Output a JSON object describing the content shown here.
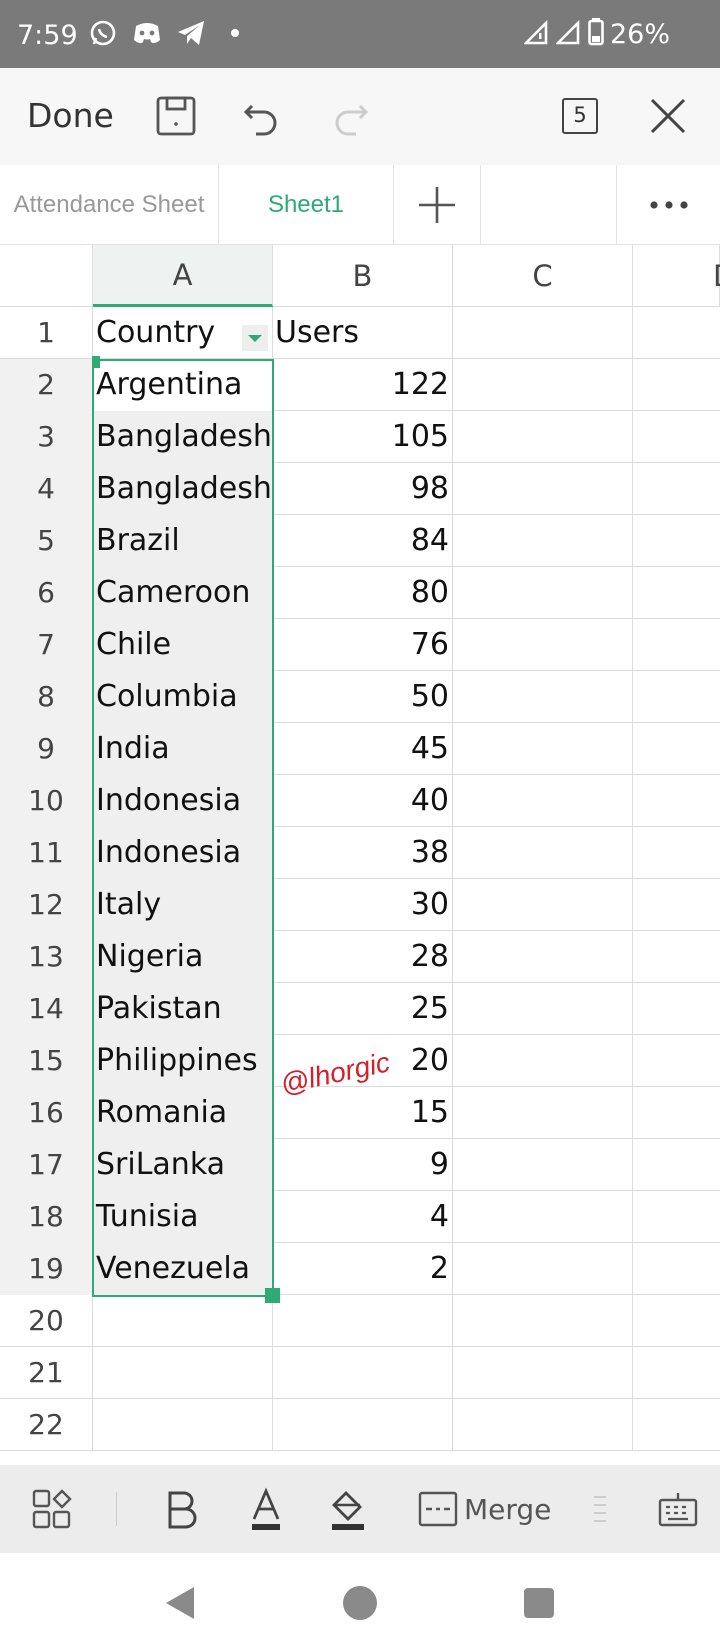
{
  "status_bar": {
    "time": "7:59",
    "battery": "26%",
    "notification_icons": [
      "whatsapp-icon",
      "discord-icon",
      "telegram-icon",
      "dot-icon"
    ]
  },
  "toolbar": {
    "done_label": "Done",
    "tab_count": "5"
  },
  "sheet_tabs": [
    {
      "label": "Attendance Sheet",
      "active": false
    },
    {
      "label": "Sheet1",
      "active": true
    }
  ],
  "columns": [
    "A",
    "B",
    "C",
    "D"
  ],
  "rows": [
    {
      "num": "1",
      "a": "Country",
      "b": "Users"
    },
    {
      "num": "2",
      "a": "Argentina",
      "b": "122"
    },
    {
      "num": "3",
      "a": "Bangladesh",
      "b": "105"
    },
    {
      "num": "4",
      "a": "Bangladesh",
      "b": "98"
    },
    {
      "num": "5",
      "a": "Brazil",
      "b": "84"
    },
    {
      "num": "6",
      "a": "Cameroon",
      "b": "80"
    },
    {
      "num": "7",
      "a": "Chile",
      "b": "76"
    },
    {
      "num": "8",
      "a": "Columbia",
      "b": "50"
    },
    {
      "num": "9",
      "a": "India",
      "b": "45"
    },
    {
      "num": "10",
      "a": "Indonesia",
      "b": "40"
    },
    {
      "num": "11",
      "a": "Indonesia",
      "b": "38"
    },
    {
      "num": "12",
      "a": "Italy",
      "b": "30"
    },
    {
      "num": "13",
      "a": "Nigeria",
      "b": "28"
    },
    {
      "num": "14",
      "a": "Pakistan",
      "b": "25"
    },
    {
      "num": "15",
      "a": "Philippines",
      "b": "20"
    },
    {
      "num": "16",
      "a": "Romania",
      "b": "15"
    },
    {
      "num": "17",
      "a": "SriLanka",
      "b": "9"
    },
    {
      "num": "18",
      "a": "Tunisia",
      "b": "4"
    },
    {
      "num": "19",
      "a": "Venezuela",
      "b": "2"
    },
    {
      "num": "20",
      "a": "",
      "b": ""
    },
    {
      "num": "21",
      "a": "",
      "b": ""
    },
    {
      "num": "22",
      "a": "",
      "b": ""
    }
  ],
  "watermark": "@lhorgic",
  "format_bar": {
    "merge_label": "Merge"
  },
  "colors": {
    "accent": "#2eaa76",
    "watermark": "#d4202a",
    "status_bar": "#7a7a7a"
  }
}
